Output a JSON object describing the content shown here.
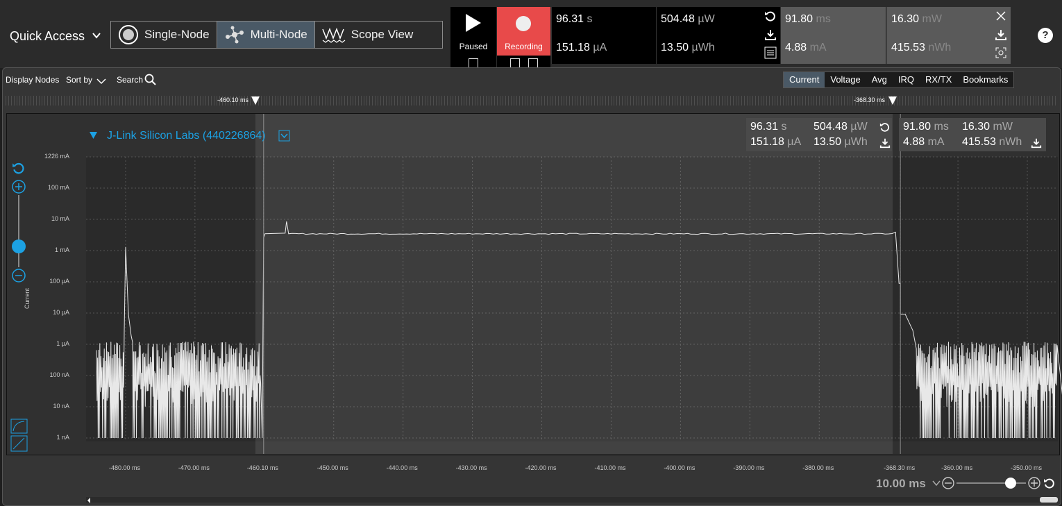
{
  "top": {
    "quick_access": "Quick Access",
    "modes": [
      "Single-Node",
      "Multi-Node",
      "Scope View"
    ],
    "paused_label": "Paused",
    "recording_label": "Recording",
    "m1": {
      "top_val": "96.31",
      "top_unit": "s",
      "bot_val": "151.18",
      "bot_unit": "µA"
    },
    "m2": {
      "top_val": "504.48",
      "top_unit": "µW",
      "bot_val": "13.50",
      "bot_unit": "µWh"
    },
    "g1": {
      "top_val": "91.80",
      "top_unit": "ms",
      "bot_val": "4.88",
      "bot_unit": "mA"
    },
    "g2": {
      "top_val": "16.30",
      "top_unit": "mW",
      "bot_val": "415.53",
      "bot_unit": "nWh"
    },
    "help": "?"
  },
  "toolbar": {
    "display_nodes": "Display Nodes",
    "sort_by": "Sort by",
    "search": "Search"
  },
  "tabs": [
    "Current",
    "Voltage",
    "Avg",
    "IRQ",
    "RX/TX",
    "Bookmarks"
  ],
  "markers": {
    "left": "-460.10 ms",
    "right": "-368.30 ms"
  },
  "node": {
    "title": "J-Link Silicon Labs (440226864)"
  },
  "mini": {
    "a": [
      "96.31",
      "s",
      "151.18",
      "µA"
    ],
    "b": [
      "504.48",
      "µW",
      "13.50",
      "µWh"
    ],
    "c": [
      "91.80",
      "ms",
      "4.88",
      "mA"
    ],
    "d": [
      "16.30",
      "mW",
      "415.53",
      "nWh"
    ]
  },
  "zoom": "10.00 ms",
  "chart_data": {
    "type": "line",
    "ylabel": "Current",
    "yticks": [
      "1226 mA",
      "100 mA",
      "10 mA",
      "1 mA",
      "100 µA",
      "10 µA",
      "1 µA",
      "100 nA",
      "10 nA",
      "1 nA"
    ],
    "xticks": [
      "-480.00 ms",
      "-470.00 ms",
      "-460.10 ms",
      "-450.00 ms",
      "-440.00 ms",
      "-430.00 ms",
      "-420.00 ms",
      "-410.00 ms",
      "-400.00 ms",
      "-390.00 ms",
      "-380.00 ms",
      "-368.30 ms",
      "-360.00 ms",
      "-350.00 ms"
    ],
    "series": [
      {
        "points": [
          [
            -484.2,
            "1 nA"
          ],
          [
            -480.0,
            "1.5 mA"
          ],
          [
            -479.0,
            "1 µA"
          ],
          [
            -460.4,
            "1 µA"
          ],
          [
            -460.1,
            "3 mA"
          ],
          [
            -457.0,
            "5 mA"
          ],
          [
            -456.8,
            "10 mA"
          ],
          [
            -456.5,
            "4 mA"
          ],
          [
            -369.0,
            "4 mA"
          ],
          [
            -368.5,
            "100 µA"
          ],
          [
            -368.3,
            "10 µA"
          ],
          [
            -366.0,
            "1 µA"
          ],
          [
            -345.0,
            "1 µA"
          ],
          [
            -344.3,
            "1 nA"
          ]
        ]
      }
    ]
  }
}
